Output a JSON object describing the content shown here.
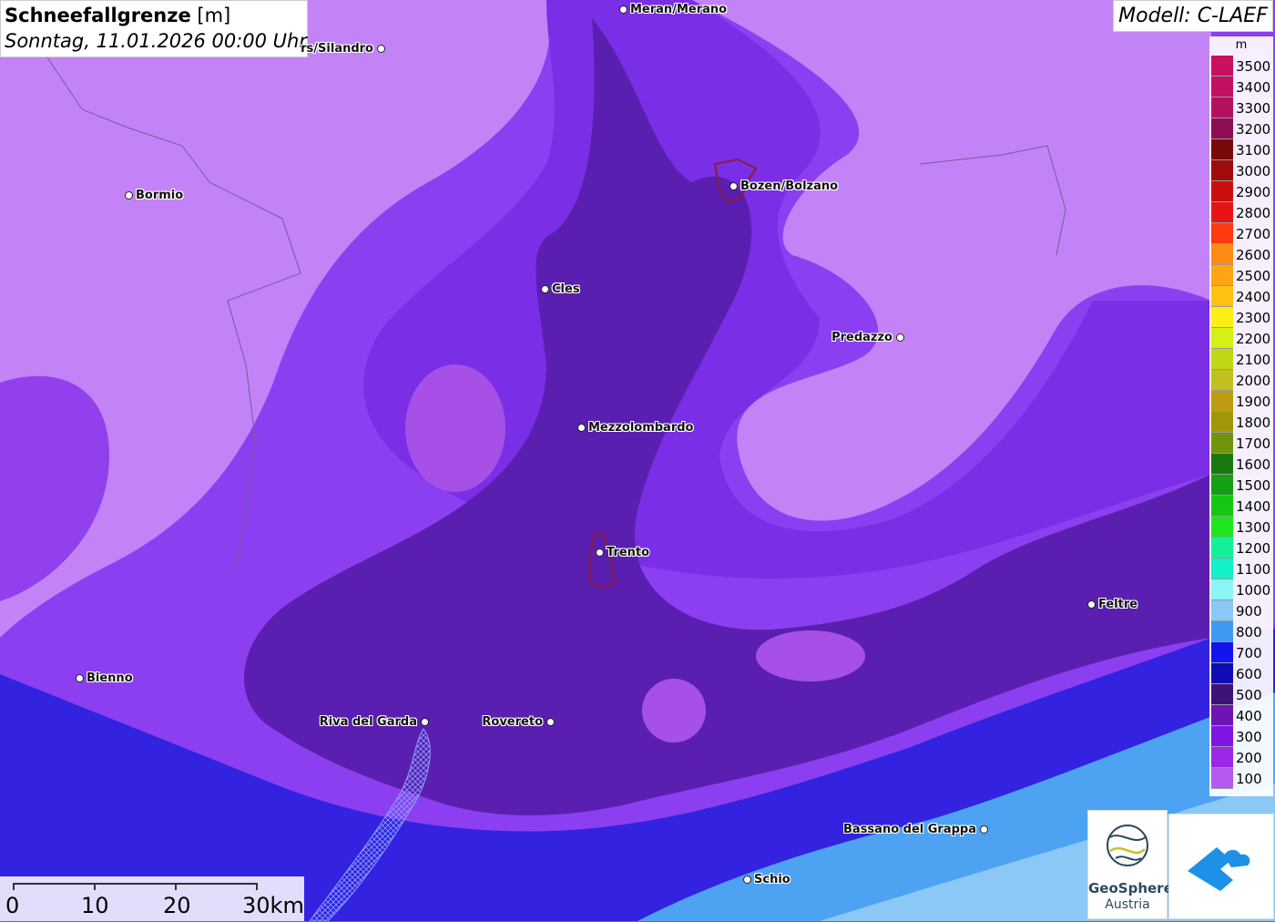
{
  "header": {
    "title": "Schneefallgrenze",
    "unit": "[m]",
    "datetime": "Sonntag, 11.01.2026 00:00 Uhr"
  },
  "model": "Modell: C-LAEF",
  "legend": {
    "unit": "m",
    "entries": [
      {
        "label": "3500",
        "color": "#c8105f"
      },
      {
        "label": "3400",
        "color": "#c21063"
      },
      {
        "label": "3300",
        "color": "#b51060"
      },
      {
        "label": "3200",
        "color": "#8e0e55"
      },
      {
        "label": "3100",
        "color": "#7a0a0a"
      },
      {
        "label": "3000",
        "color": "#a00c0c"
      },
      {
        "label": "2900",
        "color": "#c81010"
      },
      {
        "label": "2800",
        "color": "#e81414"
      },
      {
        "label": "2700",
        "color": "#ff3a10"
      },
      {
        "label": "2600",
        "color": "#ff8a14"
      },
      {
        "label": "2500",
        "color": "#ffa414"
      },
      {
        "label": "2400",
        "color": "#ffc014"
      },
      {
        "label": "2300",
        "color": "#ffee14"
      },
      {
        "label": "2200",
        "color": "#d4f014"
      },
      {
        "label": "2100",
        "color": "#c0d814"
      },
      {
        "label": "2000",
        "color": "#c0c020"
      },
      {
        "label": "1900",
        "color": "#c09a10"
      },
      {
        "label": "1800",
        "color": "#a0960a"
      },
      {
        "label": "1700",
        "color": "#70940a"
      },
      {
        "label": "1600",
        "color": "#1a7a10"
      },
      {
        "label": "1500",
        "color": "#14a014"
      },
      {
        "label": "1400",
        "color": "#14c814"
      },
      {
        "label": "1300",
        "color": "#1ee61e"
      },
      {
        "label": "1200",
        "color": "#14f09a"
      },
      {
        "label": "1100",
        "color": "#14f0c8"
      },
      {
        "label": "1000",
        "color": "#8cf5f5"
      },
      {
        "label": "900",
        "color": "#8ac8f5"
      },
      {
        "label": "800",
        "color": "#3c9af0"
      },
      {
        "label": "700",
        "color": "#1414f0"
      },
      {
        "label": "600",
        "color": "#0e0eb4"
      },
      {
        "label": "500",
        "color": "#3c1478"
      },
      {
        "label": "400",
        "color": "#6e14b4"
      },
      {
        "label": "300",
        "color": "#8214e6"
      },
      {
        "label": "200",
        "color": "#9a28e6"
      },
      {
        "label": "100",
        "color": "#b45af0"
      }
    ]
  },
  "cities": [
    {
      "name": "Meran/Merano",
      "side": "right"
    },
    {
      "name": "rs/Silandro",
      "side": "left"
    },
    {
      "name": "Bormio",
      "side": "right"
    },
    {
      "name": "Bozen/Bolzano",
      "side": "right"
    },
    {
      "name": "Cles",
      "side": "right"
    },
    {
      "name": "Predazzo",
      "side": "left"
    },
    {
      "name": "Mezzolombardo",
      "side": "right"
    },
    {
      "name": "Trento",
      "side": "right"
    },
    {
      "name": "Feltre",
      "side": "right"
    },
    {
      "name": "Bienno",
      "side": "right"
    },
    {
      "name": "Riva del Garda",
      "side": "left"
    },
    {
      "name": "Rovereto",
      "side": "left"
    },
    {
      "name": "Bassano del Grappa",
      "side": "left"
    },
    {
      "name": "Schio",
      "side": "right"
    }
  ],
  "scale": {
    "labels": [
      "0",
      "10",
      "20",
      "30km"
    ]
  },
  "logos": {
    "geosphere_name": "GeoSphere",
    "geosphere_sub": "Austria"
  }
}
